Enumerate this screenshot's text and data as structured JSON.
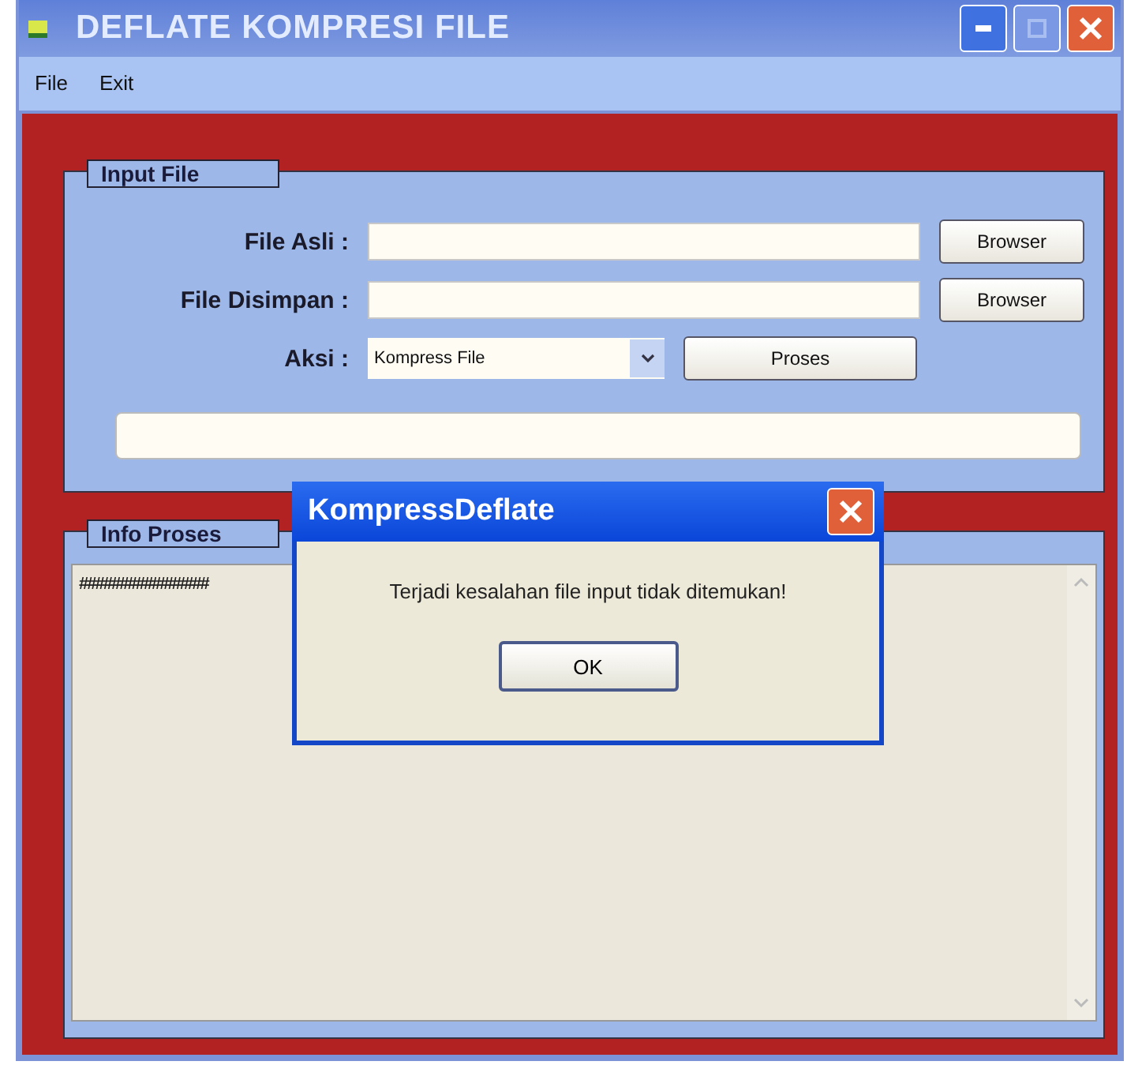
{
  "window": {
    "title": "DEFLATE KOMPRESI FILE"
  },
  "menu": [
    "File",
    "Exit"
  ],
  "input_file": {
    "title": "Input File",
    "fields": [
      {
        "label": "File Asli :",
        "button": "Browser"
      },
      {
        "label": "File Disimpan :",
        "button": "Browser"
      }
    ],
    "action": {
      "label": "Aksi :",
      "value": "Kompress File",
      "button": "Proses"
    }
  },
  "info_proses": {
    "title": "Info Proses",
    "text": "################"
  },
  "dialog": {
    "title": "KompressDeflate",
    "message": "Terjadi kesalahan file input tidak ditemukan!",
    "button": "OK"
  }
}
